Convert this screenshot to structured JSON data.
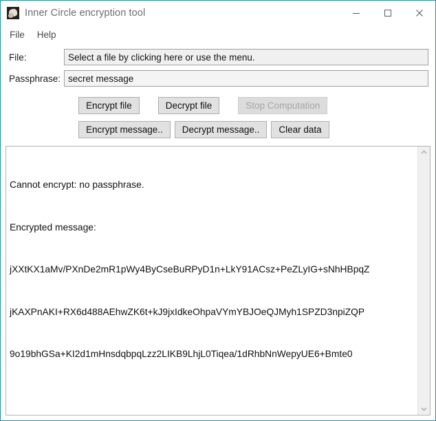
{
  "window": {
    "title": "Inner Circle encryption tool",
    "icon": "app-photo-icon",
    "border_color": "#2a8a9e",
    "controls": {
      "minimize": "minimize-icon",
      "maximize": "maximize-icon",
      "close": "close-icon"
    }
  },
  "menubar": {
    "items": [
      {
        "label": "File"
      },
      {
        "label": "Help"
      }
    ]
  },
  "form": {
    "file": {
      "label": "File:",
      "value": "Select a file by clicking here or use the menu.",
      "placeholder": "Select a file by clicking here or use the menu."
    },
    "passphrase": {
      "label": "Passphrase:",
      "value": "secret message",
      "placeholder": ""
    }
  },
  "buttons": {
    "encrypt_file": "Encrypt file",
    "decrypt_file": "Decrypt file",
    "stop_computation": "Stop Computation",
    "encrypt_message": "Encrypt message..",
    "decrypt_message": "Decrypt message..",
    "clear_data": "Clear data",
    "stop_disabled_color": "#a6a6a6"
  },
  "output": {
    "lines": [
      "Cannot encrypt: no passphrase.",
      "Encrypted message:",
      "jXXtKX1aMv/PXnDe2mR1pWy4ByCseBuRPyD1n+LkY91ACsz+PeZLyIG+sNhHBpqZ",
      "jKAXPnAKI+RX6d488AEhwZK6t+kJ9jxIdkeOhpaVYmYBJOeQJMyh1SPZD3npiZQP",
      "9o19bhGSa+KI2d1mHnsdqbpqLzz2LIKB9LhjL0Tiqea/1dRhbNnWepyUE6+Bmte0"
    ]
  },
  "scrollbar": {
    "up": "chevron-up-icon",
    "down": "chevron-down-icon"
  }
}
